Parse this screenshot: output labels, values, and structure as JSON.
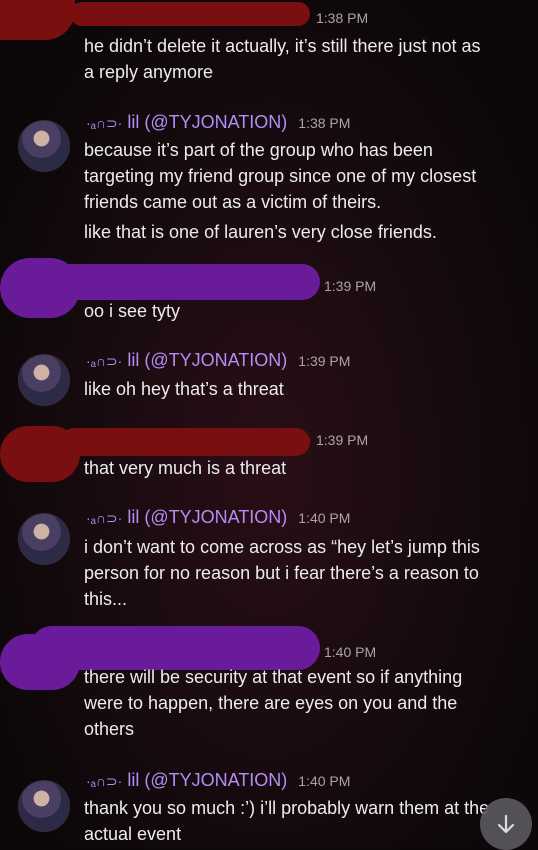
{
  "messages": [
    {
      "id": "m1",
      "time": "1:38 PM",
      "lines": [
        "he didn’t delete it actually, it’s still there just not as",
        "a reply anymore"
      ]
    },
    {
      "id": "m2",
      "author": "lil (@TYJONATION)",
      "author_prefix": "·ₐ∩⊃·",
      "time": "1:38 PM",
      "lines": [
        "because it’s part of the group who has been",
        "targeting my friend group since one of my closest",
        "friends came out as a victim of theirs.",
        "like that is one of lauren’s very close friends."
      ]
    },
    {
      "id": "m3",
      "time": "1:39 PM",
      "lines": [
        "oo i see tyty"
      ]
    },
    {
      "id": "m4",
      "author": "lil (@TYJONATION)",
      "author_prefix": "·ₐ∩⊃·",
      "time": "1:39 PM",
      "lines": [
        "like oh hey that’s a threat"
      ]
    },
    {
      "id": "m5",
      "time": "1:39 PM",
      "lines": [
        "that very much is a threat"
      ]
    },
    {
      "id": "m6",
      "author": "lil (@TYJONATION)",
      "author_prefix": "·ₐ∩⊃·",
      "time": "1:40 PM",
      "lines": [
        "i don’t want to come across as “hey let’s jump this",
        "person for no reason but i fear there’s a reason to",
        "this..."
      ]
    },
    {
      "id": "m7",
      "time": "1:40 PM",
      "lines": [
        "there will be security at that event so if anything",
        "were to happen, there are eyes on you and the",
        "others"
      ]
    },
    {
      "id": "m8",
      "author": "lil (@TYJONATION)",
      "author_prefix": "·ₐ∩⊃·",
      "time": "1:40 PM",
      "lines": [
        "thank you so much :’) i’ll probably warn them at the",
        "actual event"
      ]
    }
  ],
  "scroll_button_icon": "arrow-down-icon"
}
